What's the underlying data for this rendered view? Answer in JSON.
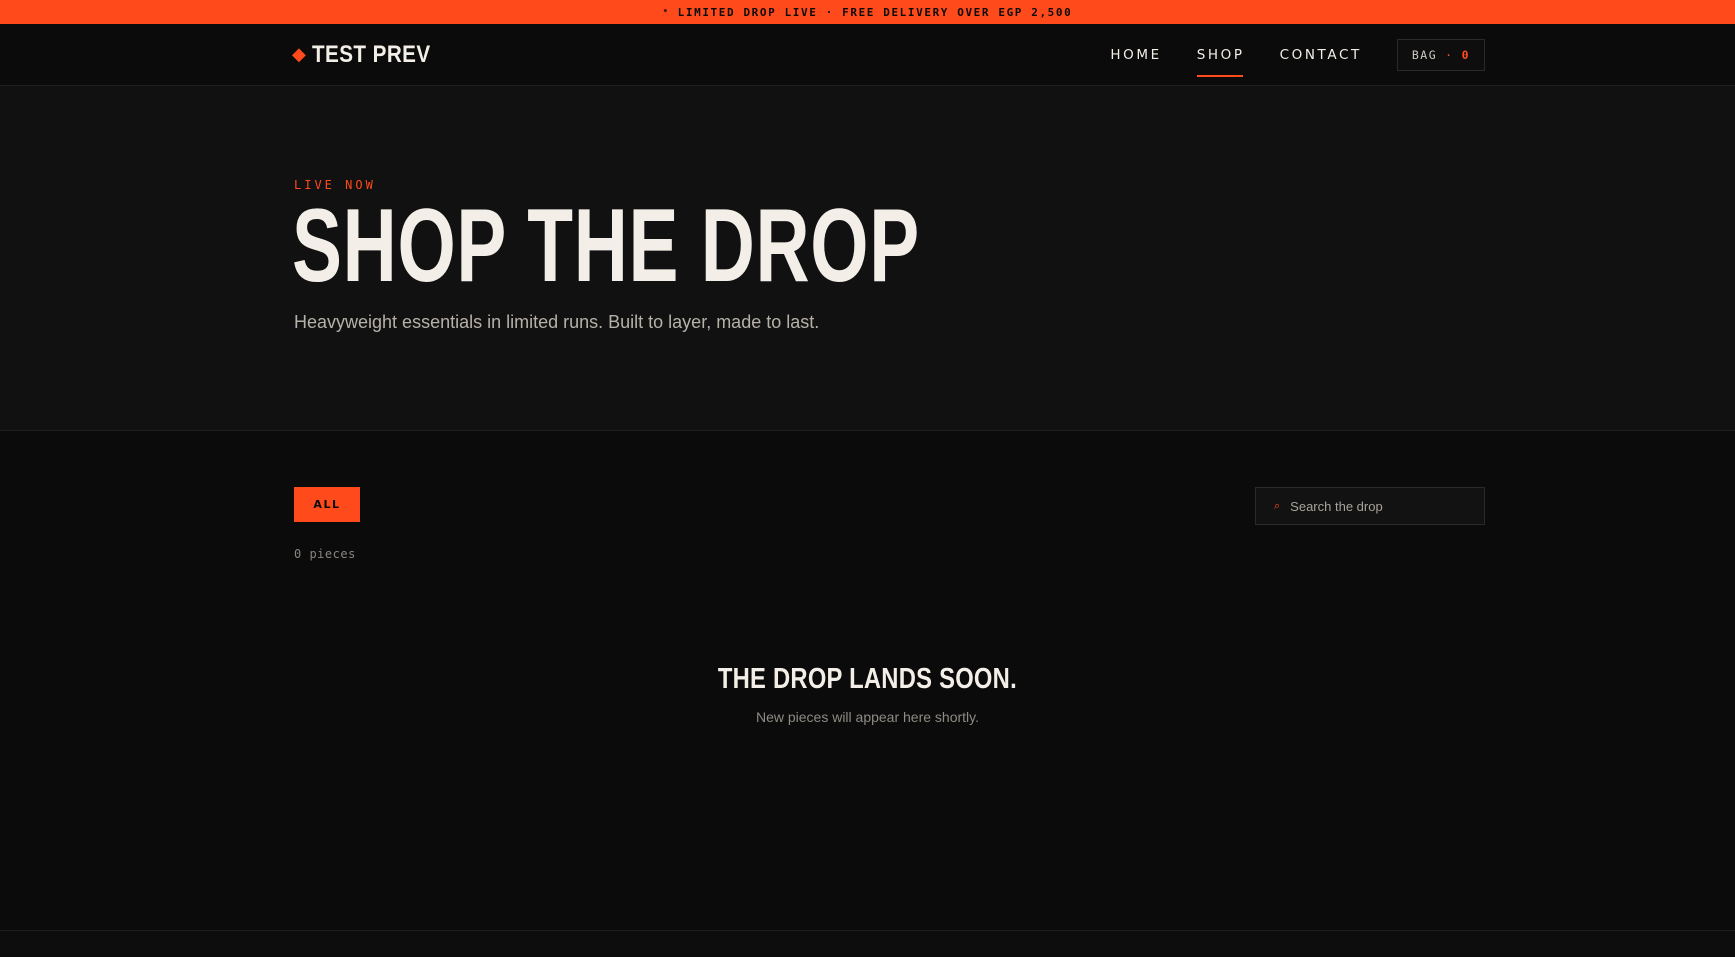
{
  "announcement": {
    "dot": "•",
    "text": "LIMITED DROP LIVE · FREE DELIVERY OVER EGP 2,500"
  },
  "header": {
    "brand_icon": "diamond-icon",
    "brand_symbol": "◆",
    "brand_name": "TEST PREV",
    "nav": [
      {
        "label": "HOME",
        "active": false
      },
      {
        "label": "SHOP",
        "active": true
      },
      {
        "label": "CONTACT",
        "active": false
      }
    ],
    "bag": {
      "label": "BAG",
      "separator": "·",
      "count": "0"
    }
  },
  "hero": {
    "eyebrow": "LIVE NOW",
    "title": "SHOP THE DROP",
    "subtitle": "Heavyweight essentials in limited runs. Built to layer, made to last."
  },
  "shop": {
    "filters": [
      {
        "label": "ALL",
        "active": true
      }
    ],
    "count_text": "0 pieces",
    "search": {
      "icon": "search-icon",
      "glyph": "⌕",
      "placeholder": "Search the drop",
      "value": ""
    },
    "empty": {
      "title": "THE DROP LANDS SOON.",
      "subtitle": "New pieces will appear here shortly."
    }
  },
  "colors": {
    "accent": "#ff4a1c",
    "background": "#0b0b0b",
    "hero_background": "#111111",
    "text": "#f3efe8"
  }
}
